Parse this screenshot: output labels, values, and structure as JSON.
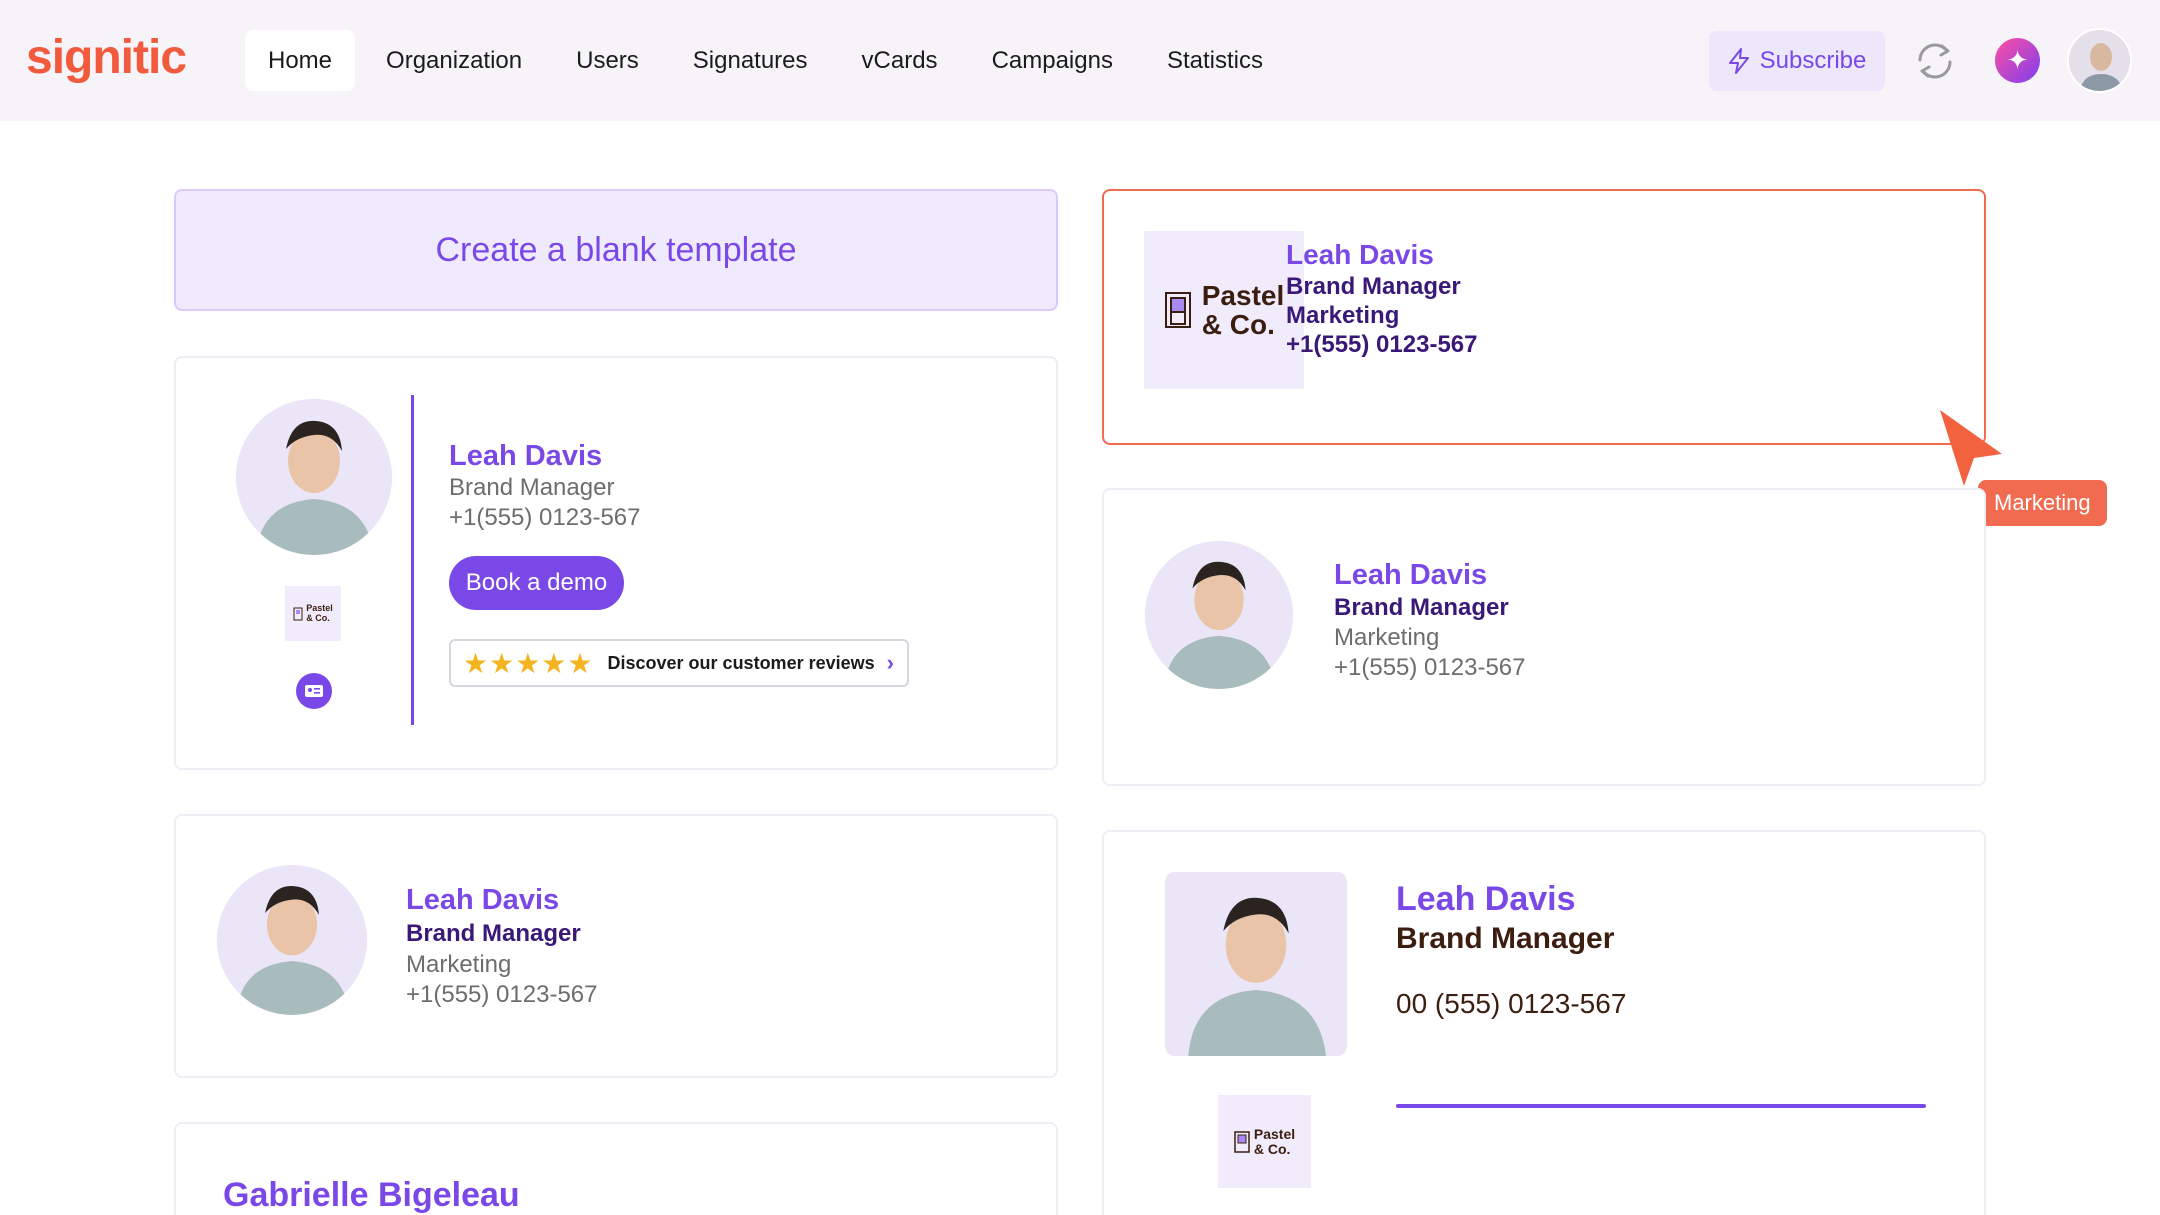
{
  "app": {
    "logo": "signitic"
  },
  "nav": {
    "items": [
      "Home",
      "Organization",
      "Users",
      "Signatures",
      "vCards",
      "Campaigns",
      "Statistics"
    ],
    "active": "Home"
  },
  "header": {
    "subscribe_label": "Subscribe"
  },
  "blank_template": {
    "label": "Create a blank template"
  },
  "templates": {
    "selected": {
      "logo_line1": "Pastel",
      "logo_line2": "& Co.",
      "name": "Leah Davis",
      "role": "Brand Manager",
      "dept": "Marketing",
      "phone": "+1(555) 0123-567"
    },
    "card_a": {
      "name": "Leah Davis",
      "role": "Brand Manager",
      "phone": "+1(555) 0123-567",
      "cta": "Book a demo",
      "reviews": "Discover our customer reviews",
      "logo_line1": "Pastel",
      "logo_line2": "& Co."
    },
    "card_b": {
      "name": "Leah Davis",
      "role": "Brand Manager",
      "dept": "Marketing",
      "phone": "+1(555) 0123-567"
    },
    "card_c": {
      "name": "Leah Davis",
      "role": "Brand Manager",
      "dept": "Marketing",
      "phone": "+1(555) 0123-567"
    },
    "card_d": {
      "name": "Leah Davis",
      "role": "Brand Manager",
      "phone": "00 (555) 0123-567",
      "logo_line1": "Pastel",
      "logo_line2": "& Co."
    },
    "card_e": {
      "name": "Gabrielle Bigeleau"
    }
  },
  "cursor_tag": "Marketing",
  "colors": {
    "brand_orange": "#f15a3c",
    "accent_purple": "#7b48e8",
    "dark_purple": "#3a1878",
    "brown_text": "#3c1e10"
  }
}
